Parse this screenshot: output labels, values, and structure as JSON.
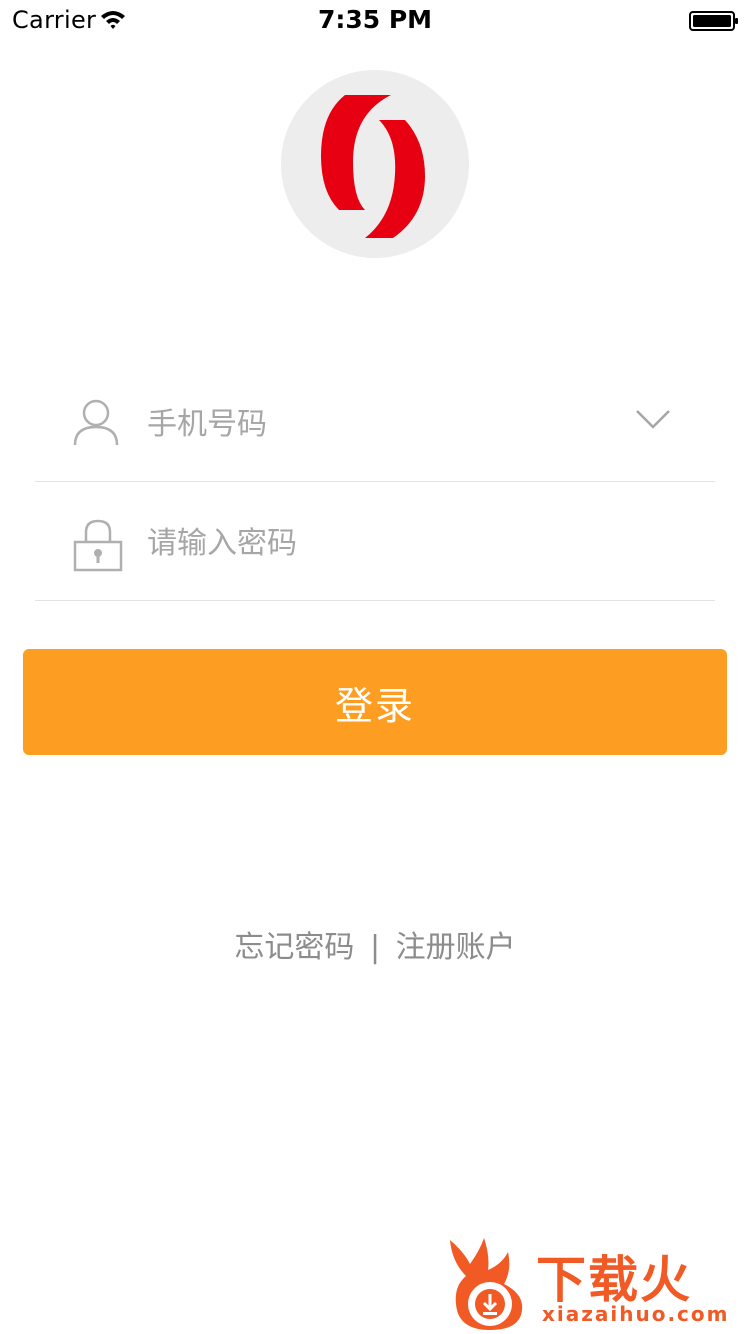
{
  "status_bar": {
    "carrier": "Carrier",
    "time": "7:35 PM"
  },
  "login_form": {
    "phone_placeholder": "手机号码",
    "password_placeholder": "请输入密码",
    "login_label": "登录"
  },
  "links": {
    "forgot_password": "忘记密码",
    "separator": "|",
    "register": "注册账户"
  },
  "watermark": {
    "title": "下载火",
    "url": "xiazaihuo.com"
  },
  "colors": {
    "accent": "#fd9e22",
    "logo_red": "#e60012",
    "divider": "#e3e3e3",
    "watermark": "#f15a24"
  },
  "icons": [
    "wifi-icon",
    "battery-icon",
    "user-icon",
    "chevron-down-icon",
    "lock-icon"
  ]
}
